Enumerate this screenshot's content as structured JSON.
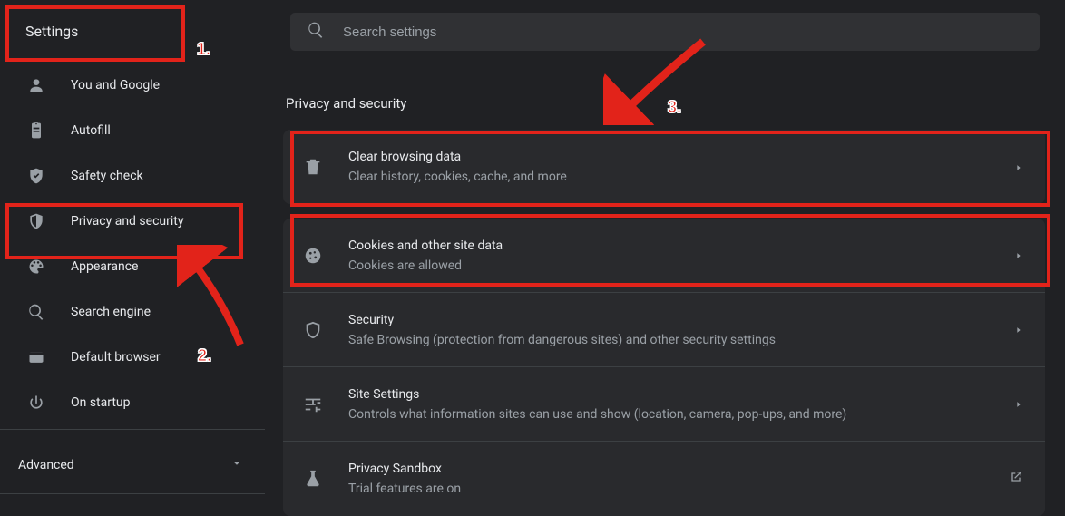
{
  "header": {
    "title": "Settings"
  },
  "search": {
    "placeholder": "Search settings"
  },
  "sidebar": {
    "items": [
      {
        "label": "You and Google",
        "icon": "person"
      },
      {
        "label": "Autofill",
        "icon": "clipboard"
      },
      {
        "label": "Safety check",
        "icon": "shield-check"
      },
      {
        "label": "Privacy and security",
        "icon": "shield"
      },
      {
        "label": "Appearance",
        "icon": "palette"
      },
      {
        "label": "Search engine",
        "icon": "search"
      },
      {
        "label": "Default browser",
        "icon": "browser"
      },
      {
        "label": "On startup",
        "icon": "power"
      }
    ],
    "advanced": "Advanced"
  },
  "main": {
    "page_title": "Privacy and security",
    "rows": [
      {
        "title": "Clear browsing data",
        "sub": "Clear history, cookies, cache, and more",
        "icon": "trash",
        "end": "chevron"
      },
      {
        "title": "Cookies and other site data",
        "sub": "Cookies are allowed",
        "icon": "cookie",
        "end": "chevron"
      },
      {
        "title": "Security",
        "sub": "Safe Browsing (protection from dangerous sites) and other security settings",
        "icon": "shield-outline",
        "end": "chevron"
      },
      {
        "title": "Site Settings",
        "sub": "Controls what information sites can use and show (location, camera, pop-ups, and more)",
        "icon": "tune",
        "end": "chevron"
      },
      {
        "title": "Privacy Sandbox",
        "sub": "Trial features are on",
        "icon": "flask",
        "end": "launch"
      }
    ]
  },
  "annotations": {
    "labels": [
      "1.",
      "2.",
      "3."
    ],
    "colors": {
      "stroke": "#e2231a"
    }
  }
}
